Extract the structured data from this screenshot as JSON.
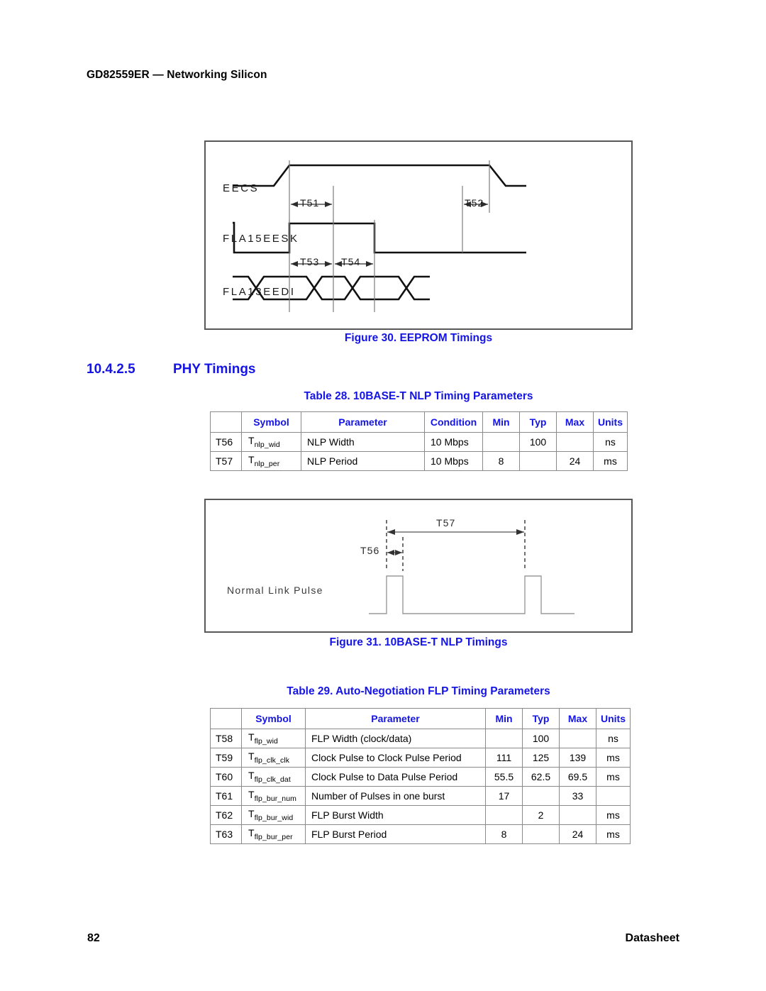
{
  "document": {
    "running_header": "GD82559ER — Networking Silicon",
    "page_number": "82",
    "footer_right": "Datasheet"
  },
  "section": {
    "number": "10.4.2.5",
    "title": "PHY Timings"
  },
  "figure30": {
    "caption": "Figure 30. EEPROM Timings",
    "signals": [
      "EECS",
      "FLA15EESK",
      "FLA13EEDI"
    ],
    "markers": [
      "T51",
      "T52",
      "T53",
      "T54"
    ]
  },
  "figure31": {
    "caption": "Figure 31. 10BASE-T NLP Timings",
    "signal_label": "Normal Link Pulse",
    "markers": [
      "T57",
      "T56"
    ]
  },
  "table28": {
    "title": "Table 28. 10BASE-T NLP Timing Parameters",
    "headers": [
      "",
      "Symbol",
      "Parameter",
      "Condition",
      "Min",
      "Typ",
      "Max",
      "Units"
    ],
    "rows": [
      {
        "id": "T56",
        "symbol_base": "T",
        "symbol_sub": "nlp_wid",
        "parameter": "NLP Width",
        "condition": "10 Mbps",
        "min": "",
        "typ": "100",
        "max": "",
        "units": "ns"
      },
      {
        "id": "T57",
        "symbol_base": "T",
        "symbol_sub": "nlp_per",
        "parameter": "NLP Period",
        "condition": "10 Mbps",
        "min": "8",
        "typ": "",
        "max": "24",
        "units": "ms"
      }
    ]
  },
  "table29": {
    "title": "Table 29. Auto-Negotiation FLP Timing Parameters",
    "headers": [
      "",
      "Symbol",
      "Parameter",
      "Min",
      "Typ",
      "Max",
      "Units"
    ],
    "rows": [
      {
        "id": "T58",
        "symbol_base": "T",
        "symbol_sub": "flp_wid",
        "parameter": "FLP Width (clock/data)",
        "min": "",
        "typ": "100",
        "max": "",
        "units": "ns"
      },
      {
        "id": "T59",
        "symbol_base": "T",
        "symbol_sub": "flp_clk_clk",
        "parameter": "Clock Pulse to Clock Pulse Period",
        "min": "111",
        "typ": "125",
        "max": "139",
        "units": "ms"
      },
      {
        "id": "T60",
        "symbol_base": "T",
        "symbol_sub": "flp_clk_dat",
        "parameter": "Clock Pulse to Data Pulse Period",
        "min": "55.5",
        "typ": "62.5",
        "max": "69.5",
        "units": "ms"
      },
      {
        "id": "T61",
        "symbol_base": "T",
        "symbol_sub": "flp_bur_num",
        "parameter": "Number of Pulses in one burst",
        "min": "17",
        "typ": "",
        "max": "33",
        "units": ""
      },
      {
        "id": "T62",
        "symbol_base": "T",
        "symbol_sub": "flp_bur_wid",
        "parameter": "FLP Burst Width",
        "min": "",
        "typ": "2",
        "max": "",
        "units": "ms"
      },
      {
        "id": "T63",
        "symbol_base": "T",
        "symbol_sub": "flp_bur_per",
        "parameter": "FLP Burst Period",
        "min": "8",
        "typ": "",
        "max": "24",
        "units": "ms"
      }
    ]
  },
  "colors": {
    "accent_blue": "#1414e6",
    "rule_gray": "#8a8a8a",
    "waveform_dark": "#111111",
    "waveform_thin": "#9a9a9a"
  }
}
